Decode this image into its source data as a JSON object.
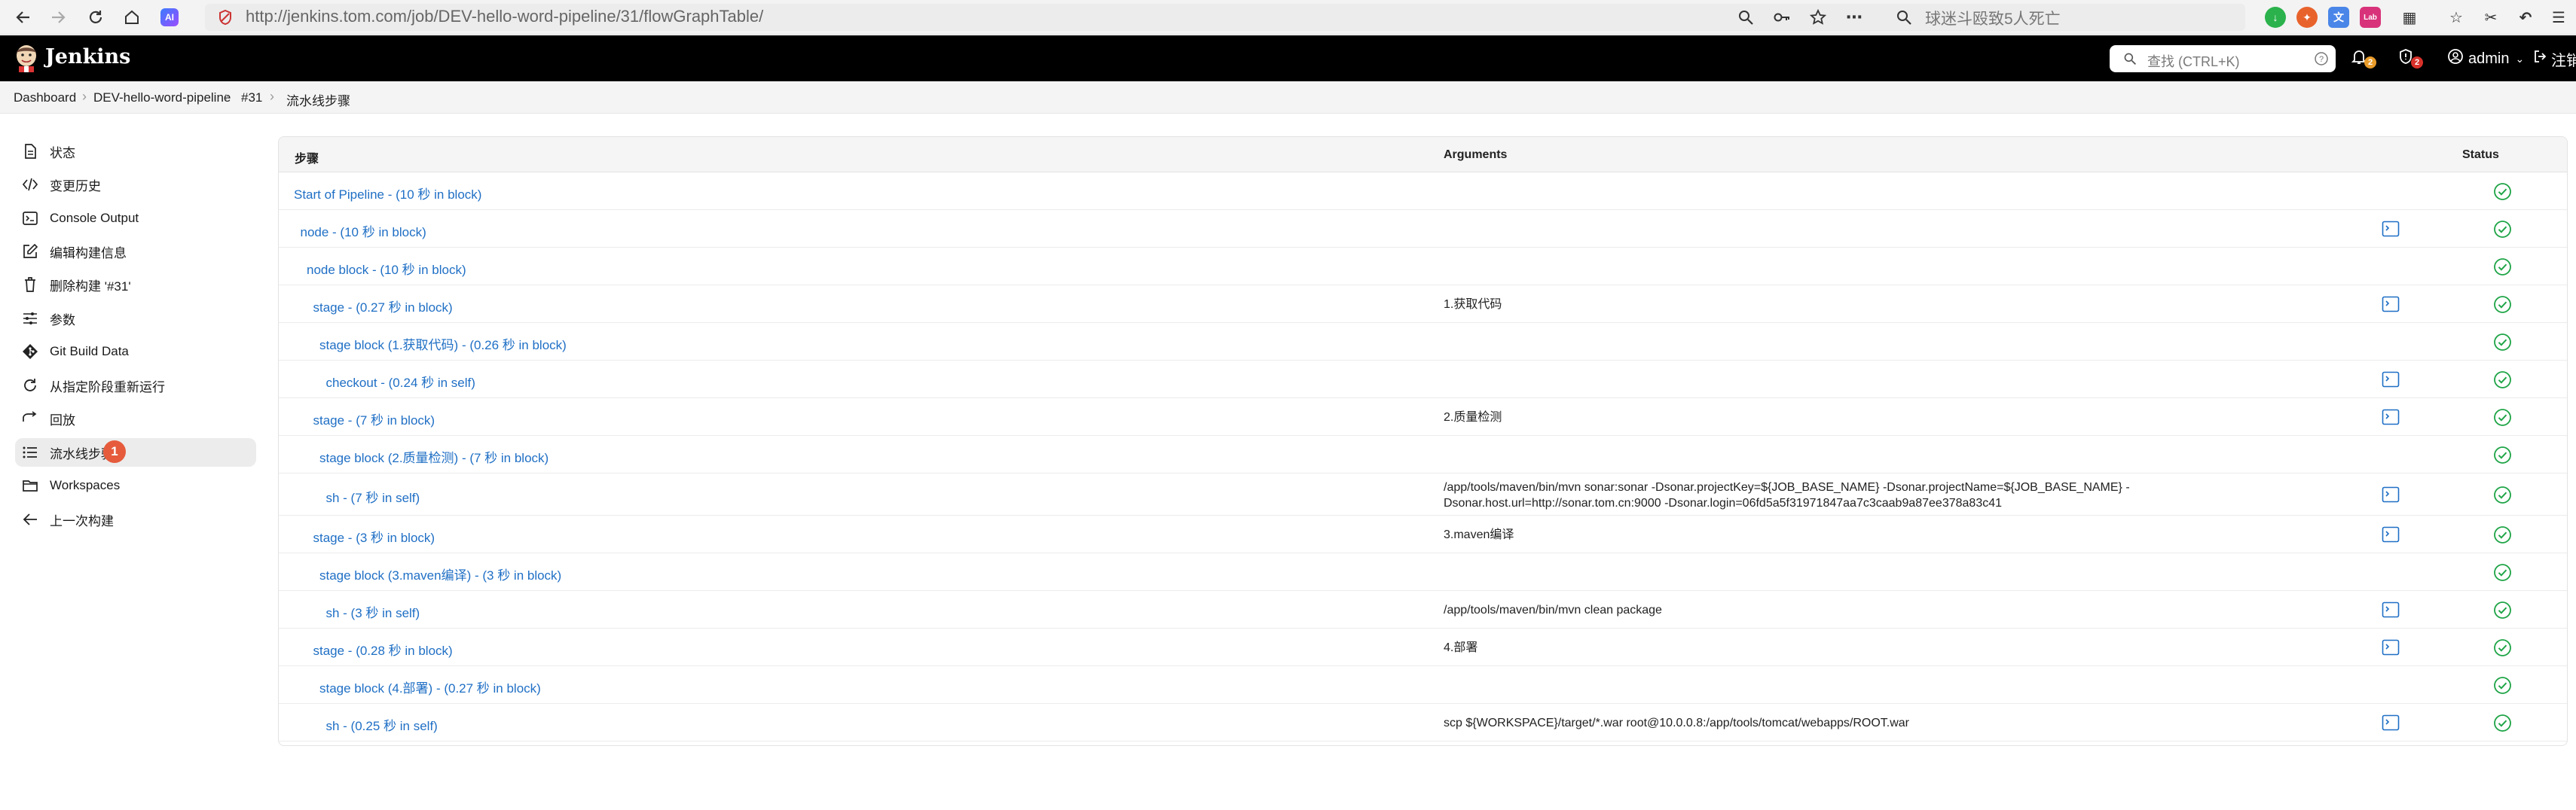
{
  "browser": {
    "url": "http://jenkins.tom.com/job/DEV-hello-word-pipeline/31/flowGraphTable/",
    "search_text": "球迷斗殴致5人死亡",
    "icons": [
      "back-icon",
      "forward-icon",
      "reload-icon",
      "home-icon",
      "ai-icon"
    ]
  },
  "header": {
    "title": "Jenkins",
    "search_placeholder": "查找 (CTRL+K)",
    "notifications_count": "2",
    "security_count": "2",
    "user": "admin",
    "logout": "注销",
    "colors": {
      "bar": "#000000",
      "notif_badge": "#e89b2a",
      "security_badge": "#d9312a"
    }
  },
  "breadcrumb": [
    "Dashboard",
    "DEV-hello-word-pipeline",
    "#31",
    "流水线步骤"
  ],
  "sidebar": {
    "items": [
      {
        "label": "状态",
        "icon": "document-icon"
      },
      {
        "label": "变更历史",
        "icon": "code-icon"
      },
      {
        "label": "Console Output",
        "icon": "terminal-icon"
      },
      {
        "label": "编辑构建信息",
        "icon": "edit-icon"
      },
      {
        "label": "删除构建 '#31'",
        "icon": "trash-icon"
      },
      {
        "label": "参数",
        "icon": "sliders-icon"
      },
      {
        "label": "Git Build Data",
        "icon": "git-icon"
      },
      {
        "label": "从指定阶段重新运行",
        "icon": "rerun-icon"
      },
      {
        "label": "回放",
        "icon": "replay-icon"
      },
      {
        "label": "流水线步骤",
        "icon": "list-icon",
        "active": true,
        "badge": "1"
      },
      {
        "label": "Workspaces",
        "icon": "folder-icon"
      },
      {
        "label": "上一次构建",
        "icon": "arrow-left-icon"
      }
    ]
  },
  "table": {
    "headers": {
      "step": "步骤",
      "arguments": "Arguments",
      "status": "Status"
    },
    "status_color": "#1ea446",
    "link_color": "#1f6fc5",
    "rows": [
      {
        "step": "Start of Pipeline - (10 秒 in block)",
        "indent": 0,
        "args": "",
        "console": false
      },
      {
        "step": "node - (10 秒 in block)",
        "indent": 1,
        "args": "",
        "console": true
      },
      {
        "step": "node block - (10 秒 in block)",
        "indent": 2,
        "args": "",
        "console": false
      },
      {
        "step": "stage - (0.27 秒 in block)",
        "indent": 3,
        "args": "1.获取代码",
        "console": true
      },
      {
        "step": "stage block (1.获取代码) - (0.26 秒 in block)",
        "indent": 4,
        "args": "",
        "console": false
      },
      {
        "step": "checkout - (0.24 秒 in self)",
        "indent": 5,
        "args": "",
        "console": true
      },
      {
        "step": "stage - (7 秒 in block)",
        "indent": 3,
        "args": "2.质量检测",
        "console": true
      },
      {
        "step": "stage block (2.质量检测) - (7 秒 in block)",
        "indent": 4,
        "args": "",
        "console": false
      },
      {
        "step": "sh - (7 秒 in self)",
        "indent": 5,
        "args": "/app/tools/maven/bin/mvn sonar:sonar -Dsonar.projectKey=${JOB_BASE_NAME} -Dsonar.projectName=${JOB_BASE_NAME} -Dsonar.host.url=http://sonar.tom.cn:9000 -Dsonar.login=06fd5a5f31971847aa7c3caab9a87ee378a83c41",
        "console": true,
        "tall": true
      },
      {
        "step": "stage - (3 秒 in block)",
        "indent": 3,
        "args": "3.maven编译",
        "console": true
      },
      {
        "step": "stage block (3.maven编译) - (3 秒 in block)",
        "indent": 4,
        "args": "",
        "console": false
      },
      {
        "step": "sh - (3 秒 in self)",
        "indent": 5,
        "args": "/app/tools/maven/bin/mvn clean package",
        "console": true
      },
      {
        "step": "stage - (0.28 秒 in block)",
        "indent": 3,
        "args": "4.部署",
        "console": true
      },
      {
        "step": "stage block (4.部署) - (0.27 秒 in block)",
        "indent": 4,
        "args": "",
        "console": false
      },
      {
        "step": "sh - (0.25 秒 in self)",
        "indent": 5,
        "args": "scp ${WORKSPACE}/target/*.war root@10.0.0.8:/app/tools/tomcat/webapps/ROOT.war",
        "console": true
      }
    ]
  }
}
